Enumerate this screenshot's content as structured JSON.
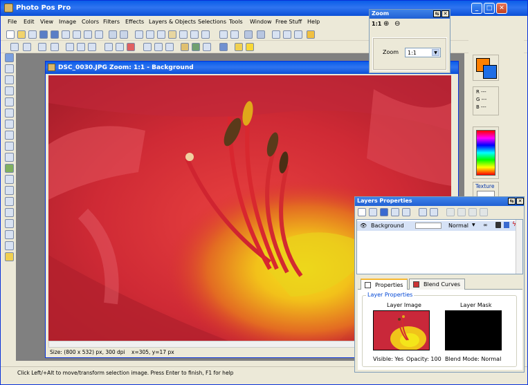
{
  "app": {
    "title": "Photo Pos Pro"
  },
  "menu": [
    "File",
    "Edit",
    "View",
    "Image",
    "Colors",
    "Filters",
    "Effects",
    "Layers & Objects",
    "Selections",
    "Tools",
    "Window",
    "Free Stuff",
    "Help"
  ],
  "document": {
    "title": "DSC_0030.JPG  Zoom: 1:1 - Background",
    "size_info": "Size: (800 x 532) px, 300 dpi",
    "cursor_info": "x=305, y=17 px"
  },
  "zoom_panel": {
    "title": "Zoom",
    "zoom_11_label": "1:1",
    "zoom_label": "Zoom",
    "zoom_value": "1:1"
  },
  "color_panel": {
    "r_label": "R ---",
    "g_label": "G ---",
    "b_label": "B ---",
    "texture_label": "Texture",
    "fg_color": "#ff8000",
    "bg_color": "#1e6ee6"
  },
  "layers_panel": {
    "title": "Layers Properties",
    "layer_name": "Background",
    "blend_mode": "Normal",
    "tabs": [
      "Properties",
      "Blend Curves"
    ],
    "group_label": "Layer Properties",
    "layer_image_label": "Layer Image",
    "layer_mask_label": "Layer Mask",
    "visible_text": "Visible: Yes",
    "opacity_text": "Opacity: 100",
    "blend_text": "Blend Mode: Normal"
  },
  "status": {
    "help_text": "Click Left/+Alt to move/transform selection image. Press Enter to finish, F1 for help"
  }
}
